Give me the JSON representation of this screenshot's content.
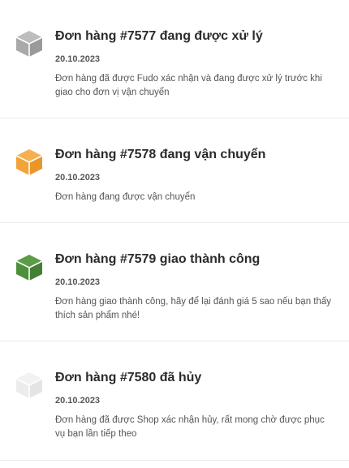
{
  "notifications": [
    {
      "title": "Đơn hàng #7577 đang được xử lý",
      "date": "20.10.2023",
      "description": "Đơn hàng đã được Fudo xác nhận và đang được xử lý trước khi giao cho đơn vị vận chuyển",
      "icon": "box-processing-icon",
      "icon_color": "#a9a9a9"
    },
    {
      "title": "Đơn hàng #7578 đang vận chuyển",
      "date": "20.10.2023",
      "description": "Đơn hàng đang được vận chuyển",
      "icon": "box-shipping-icon",
      "icon_color": "#f2a33a"
    },
    {
      "title": "Đơn hàng #7579 giao thành công",
      "date": "20.10.2023",
      "description": "Đơn hàng giao thành công, hãy để lại đánh giá 5 sao nếu bạn thấy thích sản phẩm nhé!",
      "icon": "box-delivered-icon",
      "icon_color": "#4e8f3c"
    },
    {
      "title": "Đơn hàng #7580 đã hủy",
      "date": "20.10.2023",
      "description": "Đơn hàng đã được Shop xác nhận hủy, rất mong chờ được phục vụ bạn lần tiếp theo",
      "icon": "box-cancelled-icon",
      "icon_color": "#ececec"
    }
  ]
}
